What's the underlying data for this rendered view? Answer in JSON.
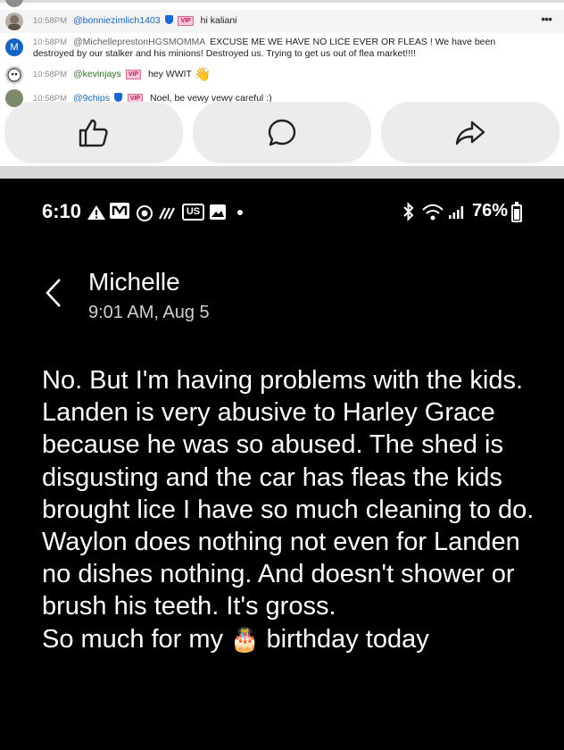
{
  "chat": {
    "messages": [
      {
        "time": "10:58PM",
        "user": "@bonniezimlich1403",
        "vip": "VIP",
        "text": "hi kaliani",
        "emoji": ""
      },
      {
        "time": "10:58PM",
        "user": "@MichelleprestonHGSMOMMA",
        "vip": "",
        "text": "EXCUSE ME WE HAVE NO LICE EVER OR FLEAS ! We have been destroyed by our stalker and his minions! Destroyed us. Trying to get us out of flea market!!!!",
        "emoji": "",
        "avatar_letter": "M"
      },
      {
        "time": "10:58PM",
        "user": "@kevinjays",
        "vip": "VIP",
        "text": "hey WWIT",
        "emoji": "👋"
      },
      {
        "time": "10:58PM",
        "user": "@9chips",
        "vip": "VIP",
        "text": "Noel, be vewy vewy careful :)",
        "emoji": ""
      }
    ],
    "actions": [
      {
        "name": "like",
        "icon": "thumbs-up-icon"
      },
      {
        "name": "comment",
        "icon": "speech-bubble-icon"
      },
      {
        "name": "share",
        "icon": "share-arrow-icon"
      }
    ]
  },
  "phone": {
    "status": {
      "clock": "6:10",
      "battery": "76%",
      "battery_level": 0.76,
      "left_icons": [
        "alert-icon",
        "m-icon",
        "target-icon",
        "wifi-calling-icon",
        "us-icon",
        "image-icon",
        "dot-icon"
      ],
      "right_icons": [
        "bluetooth-icon",
        "wifi-icon",
        "signal-icon"
      ],
      "us_label": "US"
    },
    "header": {
      "name": "Michelle",
      "time": "9:01 AM, Aug 5"
    },
    "message": {
      "text_main": "No. But I'm having problems with the kids. Landen is very abusive to Harley Grace because he was so abused. The shed is disgusting and the car has fleas the kids brought lice I have so much cleaning to do.\nWaylon does nothing not even for Landen no dishes nothing. And doesn't shower or brush his teeth. It's gross.\nSo much for my ",
      "emoji": "🎂",
      "text_end": " birthday today"
    }
  }
}
